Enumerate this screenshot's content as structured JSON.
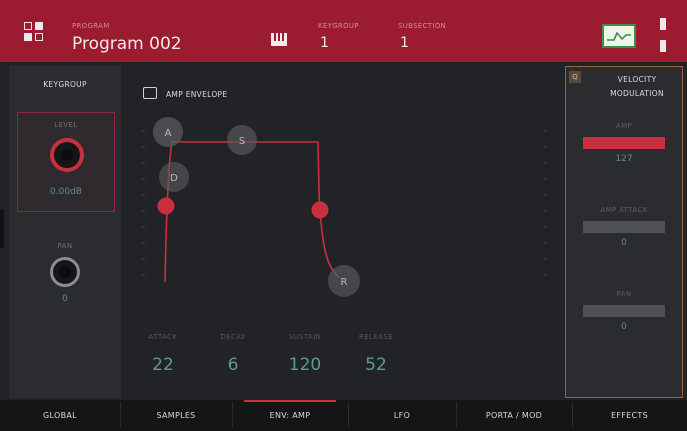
{
  "header": {
    "program_small": "PROGRAM",
    "program_name": "Program 002",
    "keygroup_small": "KEYGROUP",
    "keygroup_value": "1",
    "subsection_small": "SUBSECTION",
    "subsection_value": "1"
  },
  "keygroup_panel": {
    "title": "KEYGROUP",
    "level_label": "LEVEL",
    "level_value": "0.00dB",
    "pan_label": "PAN",
    "pan_value": "0"
  },
  "envelope": {
    "title": "AMP ENVELOPE",
    "nodes": {
      "attack": "A",
      "sustain": "S",
      "decay": "D",
      "release": "R"
    },
    "params": [
      {
        "label": "ATTACK",
        "value": "22"
      },
      {
        "label": "DECAY",
        "value": "6"
      },
      {
        "label": "SUSTAIN",
        "value": "120"
      },
      {
        "label": "RELEASE",
        "value": "52"
      }
    ]
  },
  "velocity_modulation": {
    "badge": "Q",
    "title_line1": "VELOCITY",
    "title_line2": "MODULATION",
    "rows": [
      {
        "label": "AMP",
        "value": "127",
        "fill": 1.0
      },
      {
        "label": "AMP ATTACK",
        "value": "0",
        "fill": 0.0
      },
      {
        "label": "PAN",
        "value": "0",
        "fill": 0.0
      }
    ]
  },
  "tabs": [
    {
      "label": "GLOBAL"
    },
    {
      "label": "SAMPLES"
    },
    {
      "label": "ENV: AMP"
    },
    {
      "label": "LFO"
    },
    {
      "label": "PORTA / MOD"
    },
    {
      "label": "EFFECTS"
    }
  ],
  "colors": {
    "header": "#9b1b30",
    "accent": "#c8303f",
    "value": "#5c9a96",
    "panel": "#2b2c30",
    "background": "#222326"
  },
  "icons": {
    "menu": "grid-icon",
    "piano": "piano-icon",
    "scope": "waveform-icon",
    "envelope": "envelope-icon"
  }
}
